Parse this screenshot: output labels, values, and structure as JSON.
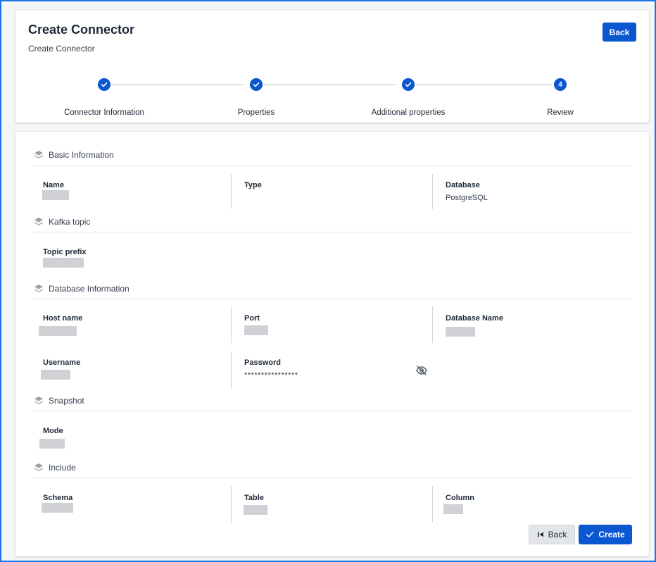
{
  "header": {
    "title": "Create Connector",
    "subtitle": "Create Connector",
    "back_label": "Back"
  },
  "stepper": {
    "steps": [
      {
        "label": "Connector Information",
        "state": "done"
      },
      {
        "label": "Properties",
        "state": "done"
      },
      {
        "label": "Additional properties",
        "state": "done"
      },
      {
        "label": "Review",
        "state": "active",
        "number": "4"
      }
    ]
  },
  "sections": {
    "basic": {
      "title": "Basic Information",
      "name_label": "Name",
      "type_label": "Type",
      "database_label": "Database",
      "database_value": "PostgreSQL"
    },
    "kafka": {
      "title": "Kafka topic",
      "topic_prefix_label": "Topic prefix"
    },
    "db_info": {
      "title": "Database Information",
      "host_label": "Host name",
      "port_label": "Port",
      "dbname_label": "Database Name",
      "username_label": "Username",
      "password_label": "Password",
      "password_value": "****************"
    },
    "snapshot": {
      "title": "Snapshot",
      "mode_label": "Mode"
    },
    "include": {
      "title": "Include",
      "schema_label": "Schema",
      "table_label": "Table",
      "column_label": "Column"
    }
  },
  "footer": {
    "back_label": "Back",
    "create_label": "Create"
  },
  "colors": {
    "primary": "#0b57d0",
    "frame": "#1a73e8"
  },
  "icons": {
    "section": "layers-icon",
    "password_toggle": "eye-off-icon",
    "back": "skip-back-icon",
    "create": "check-icon"
  }
}
